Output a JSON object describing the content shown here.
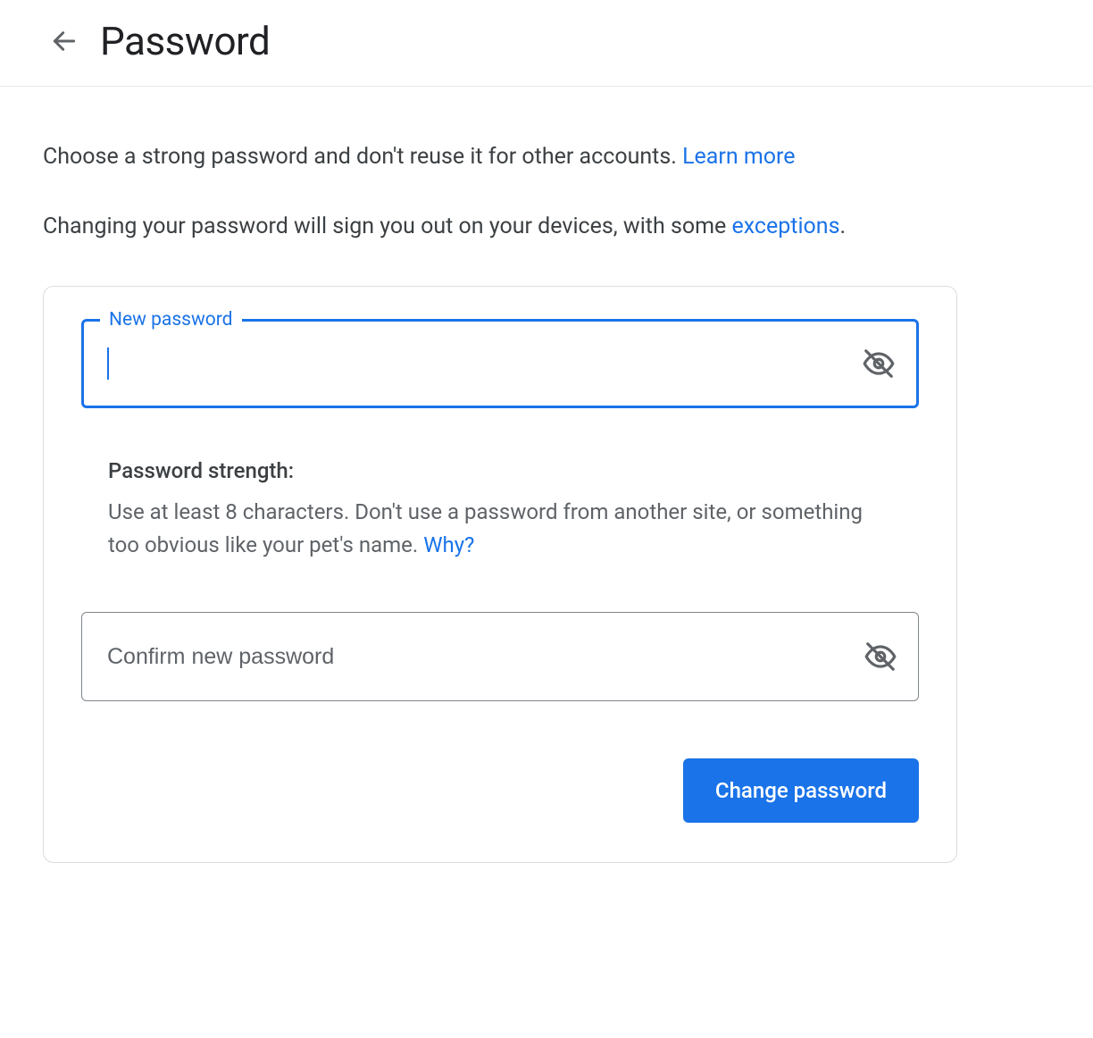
{
  "header": {
    "title": "Password"
  },
  "intro": {
    "line1_text": "Choose a strong password and don't reuse it for other accounts. ",
    "line1_link": "Learn more",
    "line2_text_a": "Changing your password will sign you out on your devices, with some ",
    "line2_link": "exceptions",
    "line2_text_b": "."
  },
  "form": {
    "new_password_label": "New password",
    "new_password_value": "",
    "confirm_placeholder": "Confirm new password",
    "confirm_value": "",
    "strength_title": "Password strength:",
    "strength_text": "Use at least 8 characters. Don't use a password from another site, or something too obvious like your pet's name. ",
    "strength_link": "Why?",
    "submit_label": "Change password"
  }
}
